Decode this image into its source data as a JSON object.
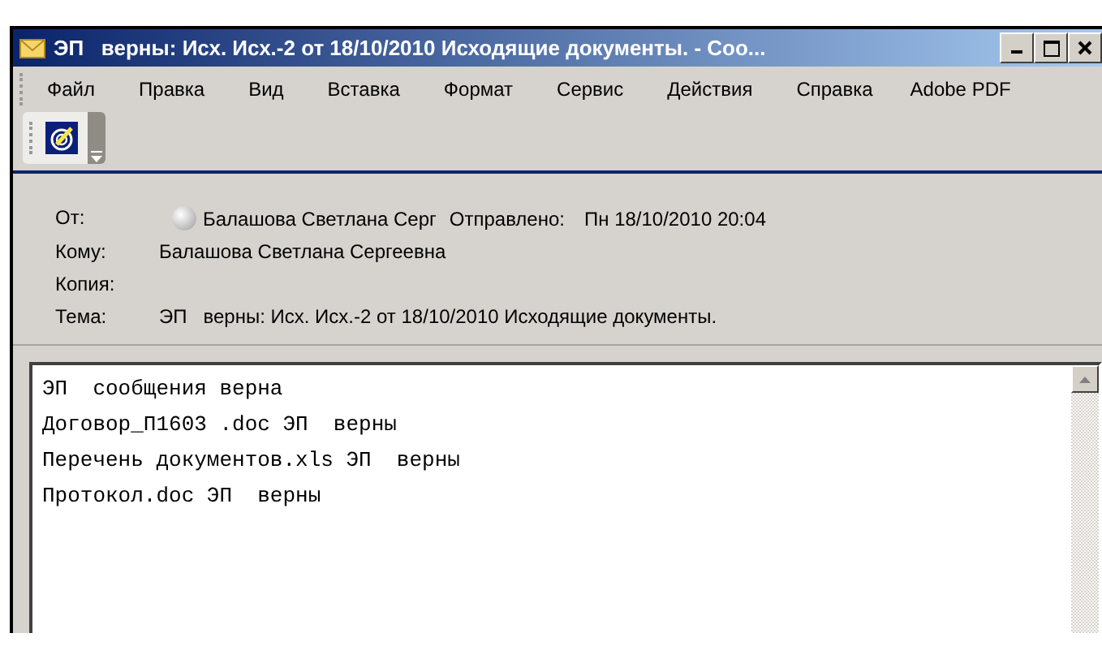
{
  "window": {
    "title": "ЭП   верны: Исх. Исх.-2 от 18/10/2010 Исходящие документы. - Соо..."
  },
  "menu": [
    "Файл",
    "Правка",
    "Вид",
    "Вставка",
    "Формат",
    "Сервис",
    "Действия",
    "Справка",
    "Adobe PDF"
  ],
  "header": {
    "from_label": "От:",
    "from": "Балашова Светлана Серг",
    "sent_label": "Отправлено:",
    "sent": "Пн 18/10/2010 20:04",
    "to_label": "Кому:",
    "to": "Балашова Светлана Сергеевна",
    "cc_label": "Копия:",
    "subject_label": "Тема:",
    "subject": "ЭП   верны: Исх. Исх.-2 от 18/10/2010 Исходящие документы."
  },
  "body_lines": [
    "ЭП  сообщения верна",
    "Договор_П1603 .doc ЭП  верны",
    "Перечень документов.xls ЭП  верны",
    "Протокол.doc ЭП  верны"
  ]
}
